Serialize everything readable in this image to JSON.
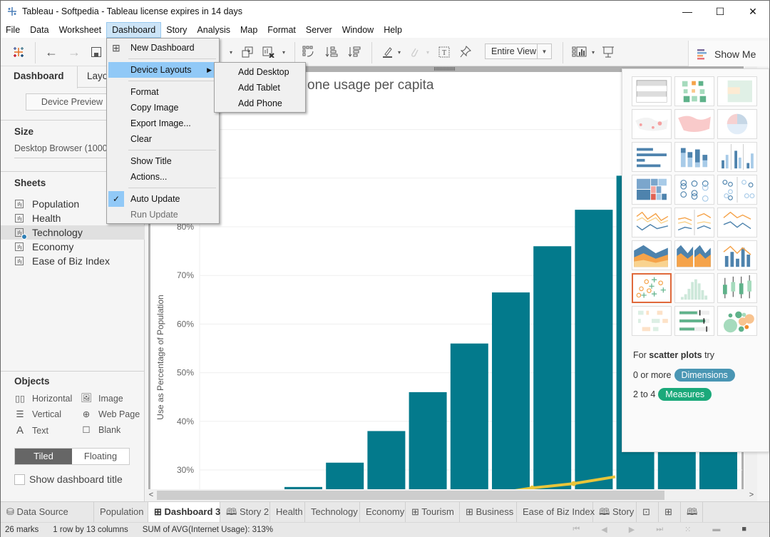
{
  "window": {
    "title": "Tableau - Softpedia - Tableau license expires in 14 days",
    "minimize_glyph": "—",
    "maximize_glyph": "☐",
    "close_glyph": "✕"
  },
  "menubar": [
    "File",
    "Data",
    "Worksheet",
    "Dashboard",
    "Story",
    "Analysis",
    "Map",
    "Format",
    "Server",
    "Window",
    "Help"
  ],
  "toolbar": {
    "fit_select": "Entire View",
    "show_me_label": "Show Me",
    "icons": [
      "tableau-logo-icon",
      "back-icon",
      "forward-icon",
      "save-icon",
      "new-worksheet-icon",
      "duplicate-icon",
      "clear-sheet-icon",
      "swap-icon",
      "sort-ascending-icon",
      "sort-descending-icon",
      "highlight-icon",
      "annotate-icon",
      "label-icon",
      "pin-icon",
      "show-cards-icon",
      "presentation-icon"
    ]
  },
  "dashboard_menu": {
    "items": [
      {
        "label": "New Dashboard",
        "icon": "new-dashboard-icon"
      },
      {
        "label": "Device Layouts",
        "submenu": true,
        "highlighted": true
      },
      {
        "label": "Format"
      },
      {
        "label": "Copy Image"
      },
      {
        "label": "Export Image..."
      },
      {
        "label": "Clear"
      },
      {
        "label": "Show Title"
      },
      {
        "label": "Actions..."
      },
      {
        "label": "Auto Update",
        "checked": true
      },
      {
        "label": "Run Update",
        "disabled": true
      }
    ]
  },
  "device_layouts_submenu": [
    "Add Desktop",
    "Add Tablet",
    "Add Phone"
  ],
  "left_panel": {
    "tabs": [
      "Dashboard",
      "Layout"
    ],
    "tab_layout_visible": "Layo",
    "device_preview": "Device Preview",
    "size_heading": "Size",
    "size_value": "Desktop Browser (1000",
    "sheets_heading": "Sheets",
    "sheets": [
      {
        "name": "Population",
        "selected": false
      },
      {
        "name": "Health",
        "selected": false
      },
      {
        "name": "Technology",
        "selected": true,
        "in_use": true
      },
      {
        "name": "Economy",
        "selected": false
      },
      {
        "name": "Ease of Biz Index",
        "selected": false
      }
    ],
    "objects_heading": "Objects",
    "objects": [
      {
        "label": "Horizontal",
        "icon": "horizontal-icon"
      },
      {
        "label": "Image",
        "icon": "image-icon"
      },
      {
        "label": "Vertical",
        "icon": "vertical-icon"
      },
      {
        "label": "Web Page",
        "icon": "globe-icon"
      },
      {
        "label": "Text",
        "icon": "text-icon"
      },
      {
        "label": "Blank",
        "icon": "blank-icon"
      }
    ],
    "tiled": "Tiled",
    "floating": "Floating",
    "show_dashboard_title": "Show dashboard title"
  },
  "chart_data": {
    "type": "bar",
    "title": "...one usage per capita",
    "title_visible": "one usage per capita",
    "xlabel": "",
    "ylabel": "Use as Percentage of Population",
    "ylim": [
      25,
      110
    ],
    "yticks": [
      "30%",
      "40%",
      "50%",
      "60%",
      "70%",
      "80%"
    ],
    "grid": true,
    "bar_color": "#037a8c",
    "line_color": "#e8c53a",
    "columns_total": 13,
    "visible_bars": [
      {
        "index": 4,
        "value": 26.5
      },
      {
        "index": 5,
        "value": 31.5
      },
      {
        "index": 6,
        "value": 38
      },
      {
        "index": 7,
        "value": 46
      },
      {
        "index": 8,
        "value": 56
      },
      {
        "index": 9,
        "value": 66.5
      },
      {
        "index": 10,
        "value": 76
      },
      {
        "index": 11,
        "value": 83.5
      },
      {
        "index": 12,
        "value": 90.5
      },
      {
        "index": 13,
        "value": 91
      },
      {
        "index": 14,
        "value": 91.5
      }
    ],
    "line_series": [
      {
        "index": 8,
        "value": 25
      },
      {
        "index": 9,
        "value": 26.3
      },
      {
        "index": 10,
        "value": 27.2
      },
      {
        "index": 11,
        "value": 28.6
      }
    ]
  },
  "show_me": {
    "hint_prefix": "For",
    "hint_bold": "scatter plots",
    "hint_suffix": "try",
    "dims_prefix": "0 or more",
    "dims_label": "Dimensions",
    "dims_color": "#4a96b4",
    "meas_prefix": "2 to 4",
    "meas_label": "Measures",
    "meas_color": "#1ba97a",
    "selected": "scatter-plot",
    "charts": [
      "text-table",
      "heat-map",
      "highlight-table",
      "symbol-map",
      "filled-map",
      "pie-chart",
      "horizontal-bars",
      "stacked-bars",
      "side-by-side-bars",
      "treemap",
      "circle-views",
      "side-by-side-circles",
      "lines-continuous",
      "lines-discrete",
      "dual-lines",
      "area-continuous",
      "area-discrete",
      "dual-combination",
      "scatter-plot",
      "histogram",
      "box-and-whisker",
      "gantt-chart",
      "bullet-graph",
      "packed-bubbles"
    ]
  },
  "sheet_tabs": [
    {
      "label": "Data Source",
      "icon": "database-icon"
    },
    {
      "label": "Population"
    },
    {
      "label": "Dashboard 3",
      "icon": "dashboard-icon",
      "current": true
    },
    {
      "label": "Story 2",
      "icon": "story-icon"
    },
    {
      "label": "Health"
    },
    {
      "label": "Technology"
    },
    {
      "label": "Economy"
    },
    {
      "label": "Tourism",
      "icon": "dashboard-icon"
    },
    {
      "label": "Business",
      "icon": "dashboard-icon"
    },
    {
      "label": "Ease of Biz Index"
    },
    {
      "label": "Story",
      "icon": "story-icon"
    }
  ],
  "status": {
    "marks": "26 marks",
    "dims": "1 row by 13 columns",
    "sum": "SUM of AVG(Internet Usage): 313%"
  }
}
